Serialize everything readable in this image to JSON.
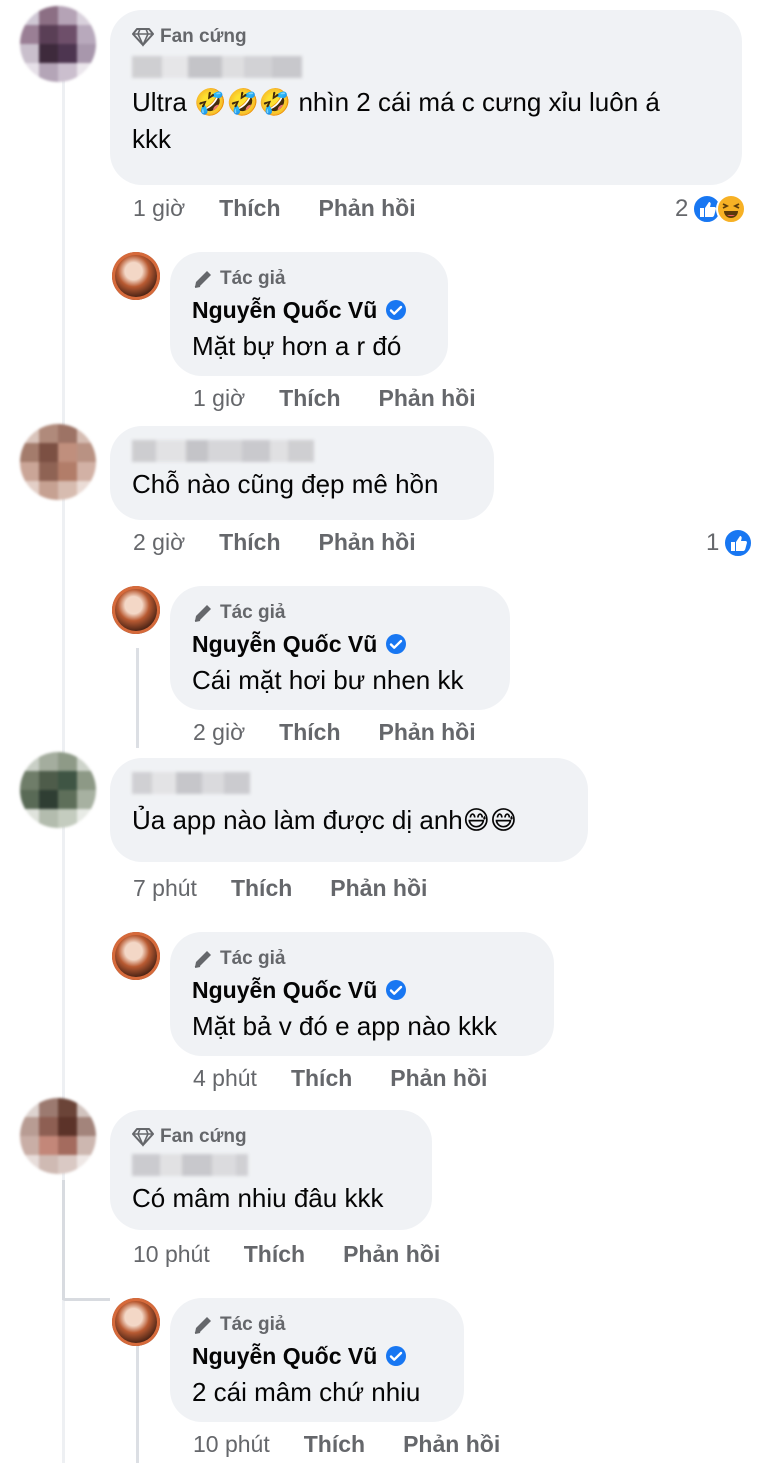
{
  "labels": {
    "fan_badge": "Fan cứng",
    "author_badge": "Tác giả",
    "like": "Thích",
    "reply": "Phản hồi"
  },
  "author_name": "Nguyễn Quốc Vũ",
  "comments": [
    {
      "text_line1": "Ultra 🤣🤣🤣 nhìn 2 cái má c cưng xỉu luôn á",
      "text_line2": "kkk",
      "time": "1 giờ",
      "reaction_count": "2",
      "reply": {
        "text": "Mặt bự hơn a r đó",
        "time": "1 giờ"
      }
    },
    {
      "text": "Chỗ nào cũng đẹp mê hồn",
      "time": "2 giờ",
      "reaction_count": "1",
      "reply": {
        "text": "Cái mặt hơi bư nhen kk",
        "time": "2 giờ"
      }
    },
    {
      "text": "Ủa app nào làm được dị anh😅😅",
      "time": "7 phút",
      "reply": {
        "text": "Mặt bả v đó e app nào kkk",
        "time": "4 phút"
      }
    },
    {
      "text": "Có mâm nhiu đâu kkk",
      "time": "10 phút",
      "reply": {
        "text": "2 cái mâm chứ nhiu",
        "time": "10 phút"
      }
    }
  ],
  "colors": {
    "bubble": "#f0f2f5",
    "meta": "#65676b",
    "like_blue": "#1877f2",
    "verified": "#1877f2"
  }
}
